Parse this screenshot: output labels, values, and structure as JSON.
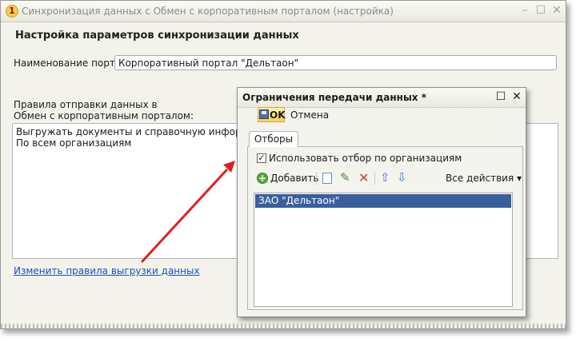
{
  "window": {
    "title": "Синхронизация данных с Обмен с корпоративным порталом (настройка)",
    "heading": "Настройка параметров синхронизации данных",
    "portal_label": "Наименование портала:",
    "portal_value": "Корпоративный портал \"Дельтаон\"",
    "rules_label_line1": "Правила отправки данных в",
    "rules_label_line2": "Обмен с корпоративным порталом:",
    "rules_text_line1": "Выгружать документы и справочную информацию:",
    "rules_text_line2": "По всем организациям",
    "change_rules_link": "Изменить правила выгрузки данных"
  },
  "dialog": {
    "title": "Ограничения передачи данных *",
    "ok_label": "OK",
    "cancel_label": "Отмена",
    "tab_label": "Отборы",
    "use_filter_label": "Использовать отбор по организациям",
    "use_filter_checked": true,
    "add_label": "Добавить",
    "all_actions_label": "Все действия ▾",
    "rows": [
      "ЗАО \"Дельтаон\""
    ]
  },
  "icons": {
    "app": "1c-app-icon",
    "add": "add-icon",
    "copy": "copy-icon",
    "edit": "edit-icon",
    "delete": "delete-icon",
    "up": "arrow-up-icon",
    "down": "arrow-down-icon"
  },
  "colors": {
    "accent_arrow": "#e02020",
    "selection": "#3a5f9e",
    "link": "#1f4fb3"
  }
}
